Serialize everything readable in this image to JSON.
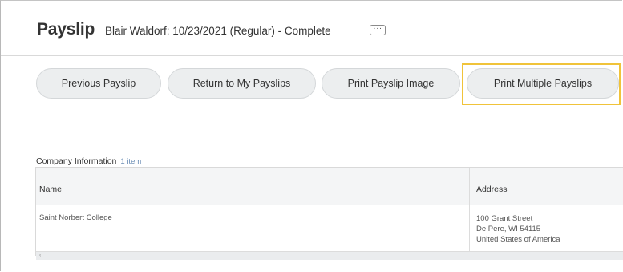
{
  "header": {
    "title": "Payslip",
    "subtitle": "Blair Waldorf: 10/23/2021 (Regular) - Complete",
    "more_label": "···"
  },
  "actions": [
    {
      "label": "Previous Payslip"
    },
    {
      "label": "Return to My Payslips"
    },
    {
      "label": "Print Payslip Image"
    },
    {
      "label": "Print Multiple Payslips",
      "highlighted": true
    }
  ],
  "colors": {
    "highlight": "#f0c33a",
    "button_bg": "#eceeef",
    "count_link": "#6b8eb5"
  },
  "company_section": {
    "title": "Company Information",
    "count": "1 item",
    "columns": [
      "Name",
      "Address"
    ],
    "rows": [
      {
        "name": "Saint Norbert College",
        "address": [
          "100 Grant Street",
          "De Pere, WI 54115",
          "United States of America"
        ]
      }
    ],
    "scroll_left_icon": "‹"
  }
}
